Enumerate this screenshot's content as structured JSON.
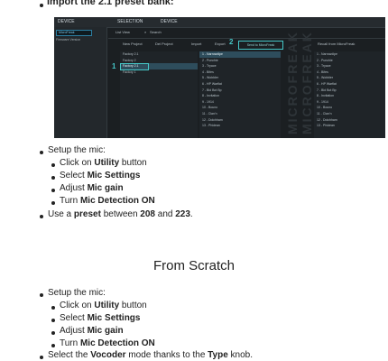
{
  "top_bullet": {
    "text": "Import the 2.1 preset bank:"
  },
  "screenshot": {
    "tabs": {
      "device_left": "DEVICE",
      "selection": "SELECTION",
      "device": "DEVICE"
    },
    "sidebar": {
      "device_value": "MicroFreak",
      "firmware_label": "Firmware Version"
    },
    "toolbar": {
      "list_view": "List View",
      "search": "Search",
      "new_project": "New Project",
      "del_project": "Del Project",
      "import": "Import",
      "export": "Export",
      "send_button": "Send to MicroFreak",
      "recall_button": "Recall from MicroFreak"
    },
    "callouts": {
      "one": "1",
      "two": "2"
    },
    "projects": [
      "Factory 2.1",
      "Factory 2",
      "Factory 2.1",
      "Factory 1"
    ],
    "presets": [
      "1 - Narrowdipe",
      "2 - Punchie",
      "3 - Tryace",
      "4 - Bifes",
      "5 - Wobbler",
      "6 - HP Warflat",
      "7 - Bid Bot Bp",
      "8 - Invitation",
      "9 - 1914",
      "10 - Bouno",
      "11 - Clan'n",
      "12 - Dolchham",
      "13 - Phidean"
    ],
    "device_presets": [
      "1 - Narrowdipe",
      "2 - Punchie",
      "3 - Tryace",
      "4 - Bifes",
      "5 - Wobbler",
      "6 - HP Warflat",
      "7 - Bid Bot Bp",
      "8 - Invitation",
      "9 - 1914",
      "10 - Bouno",
      "11 - Clan'n",
      "12 - Dolchham",
      "13 - Phidean"
    ],
    "watermark_left": "MICROFREAK",
    "watermark_right": "MICROFREAK"
  },
  "section1": {
    "setup": "Setup the mic:",
    "click_prefix": "Click on ",
    "click_strong": "Utility",
    "click_suffix": " button",
    "select_prefix": "Select ",
    "select_strong": "Mic Settings",
    "adjust_prefix": "Adjust ",
    "adjust_strong": "Mic gain",
    "turn_prefix": "Turn ",
    "turn_strong": "Mic Detection ON",
    "use_prefix": "Use a ",
    "use_strong1": "preset",
    "use_mid": " between ",
    "use_strong2": "208",
    "use_and": " and ",
    "use_strong3": "223",
    "use_end": "."
  },
  "section2": {
    "heading": "From Scratch",
    "setup": "Setup the mic:",
    "click_prefix": "Click on ",
    "click_strong": "Utility",
    "click_suffix": " button",
    "select_prefix": "Select ",
    "select_strong": "Mic Settings",
    "adjust_prefix": "Adjust ",
    "adjust_strong": "Mic gain",
    "turn_prefix": "Turn ",
    "turn_strong": "Mic Detection ON",
    "vocoder_prefix": "Select the ",
    "vocoder_strong1": "Vocoder",
    "vocoder_mid": " mode thanks to the ",
    "vocoder_strong2": "Type",
    "vocoder_end": " knob."
  }
}
